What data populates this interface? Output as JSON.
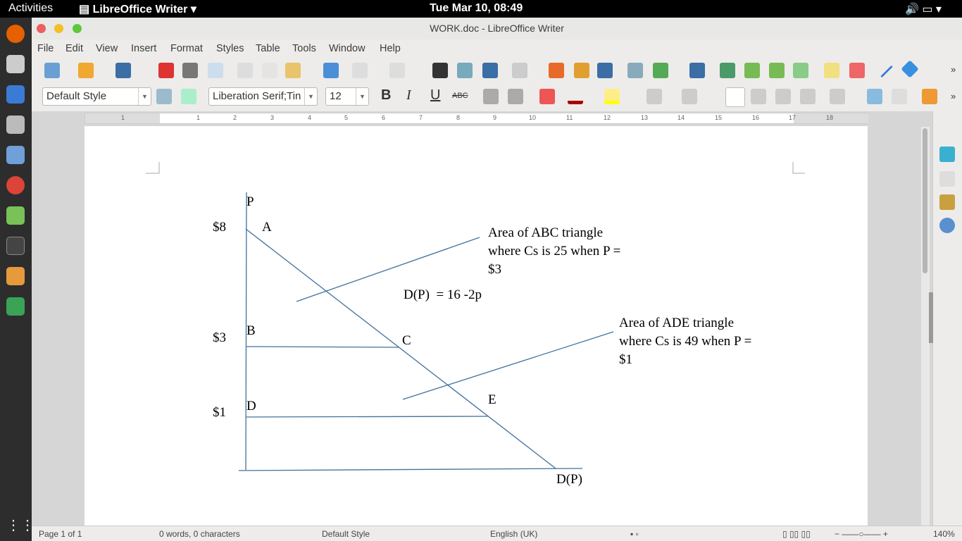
{
  "topbar": {
    "activities": "Activities",
    "app": "LibreOffice Writer ▾",
    "clock": "Tue Mar 10, 08:49"
  },
  "window": {
    "title": "WORK.doc - LibreOffice Writer"
  },
  "menu": [
    "File",
    "Edit",
    "View",
    "Insert",
    "Format",
    "Styles",
    "Table",
    "Tools",
    "Window",
    "Help"
  ],
  "format_bar": {
    "paragraph_style": "Default Style",
    "font_name": "Liberation Serif;Tin",
    "font_size": "12",
    "bold": "B",
    "italic": "I",
    "underline": "U",
    "strike": "ABC"
  },
  "ruler": {
    "ticks": [
      "1",
      "1",
      "2",
      "3",
      "4",
      "5",
      "6",
      "7",
      "8",
      "9",
      "10",
      "11",
      "12",
      "13",
      "14",
      "15",
      "16",
      "17",
      "18"
    ]
  },
  "document": {
    "axis_p": "P",
    "price_8": "$8",
    "point_a": "A",
    "price_3": "$3",
    "point_b": "B",
    "point_c": "C",
    "price_1": "$1",
    "point_d": "D",
    "point_e": "E",
    "curve_label": "D(P)",
    "equation": "D(P)  = 16 -2p",
    "note_abc": [
      "Area of ABC triangle",
      "where Cs is 25 when P =",
      "$3"
    ],
    "note_ade": [
      "Area of ADE triangle",
      "where Cs is 49 when P =",
      "$1"
    ]
  },
  "status": {
    "page": "Page 1 of 1",
    "words": "0 words, 0 characters",
    "style": "Default Style",
    "language": "English (UK)",
    "zoom": "140%"
  }
}
